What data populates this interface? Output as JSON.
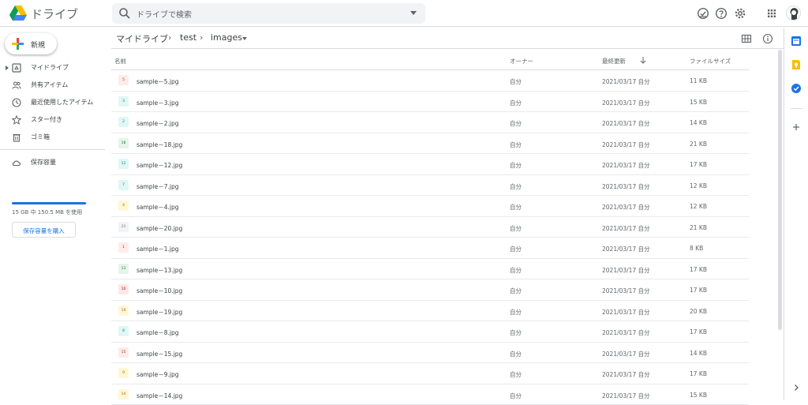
{
  "app": {
    "title": "ドライブ"
  },
  "search": {
    "placeholder": "ドライブで検索"
  },
  "topbar": {
    "icons": [
      "offline-status-icon",
      "help-icon",
      "settings-icon",
      "apps-grid-icon"
    ]
  },
  "sidebar": {
    "new_label": "新規",
    "items": [
      {
        "label": "マイドライブ",
        "icon": "my-drive-icon"
      },
      {
        "label": "共有アイテム",
        "icon": "shared-icon"
      },
      {
        "label": "最近使用したアイテム",
        "icon": "recent-icon"
      },
      {
        "label": "スター付き",
        "icon": "star-icon"
      },
      {
        "label": "ゴミ箱",
        "icon": "trash-icon"
      },
      {
        "label": "保存容量",
        "icon": "cloud-icon"
      }
    ],
    "storage_text": "15 GB 中 150.5 MB を使用",
    "storage_fraction": 0.98,
    "buy_label": "保存容量を購入"
  },
  "breadcrumb": {
    "root": "マイドライブ",
    "mid": "test",
    "current": "images",
    "sep": "›"
  },
  "columns": {
    "name": "名前",
    "owner": "オーナー",
    "modified": "最終更新",
    "size": "ファイルサイズ"
  },
  "files": [
    {
      "name": "sample－5.jpg",
      "thumb": "5",
      "owner": "自分",
      "modified": "2021/03/17 自分",
      "size": "11 KB",
      "color": "#fdecea",
      "fg": "#c5221f"
    },
    {
      "name": "sample－3.jpg",
      "thumb": "3",
      "owner": "自分",
      "modified": "2021/03/17 自分",
      "size": "15 KB",
      "color": "#e0f7f5",
      "fg": "#12857a"
    },
    {
      "name": "sample－2.jpg",
      "thumb": "2",
      "owner": "自分",
      "modified": "2021/03/17 自分",
      "size": "14 KB",
      "color": "#e0f7f5",
      "fg": "#12857a"
    },
    {
      "name": "sample－18.jpg",
      "thumb": "18",
      "owner": "自分",
      "modified": "2021/03/17 自分",
      "size": "21 KB",
      "color": "#e6f4ea",
      "fg": "#188038"
    },
    {
      "name": "sample－12.jpg",
      "thumb": "12",
      "owner": "自分",
      "modified": "2021/03/17 自分",
      "size": "17 KB",
      "color": "#e0f7f5",
      "fg": "#12857a"
    },
    {
      "name": "sample－7.jpg",
      "thumb": "7",
      "owner": "自分",
      "modified": "2021/03/17 自分",
      "size": "12 KB",
      "color": "#e0f7f5",
      "fg": "#12857a"
    },
    {
      "name": "sample－4.jpg",
      "thumb": "4",
      "owner": "自分",
      "modified": "2021/03/17 自分",
      "size": "12 KB",
      "color": "#fef7d6",
      "fg": "#b06000"
    },
    {
      "name": "sample－20.jpg",
      "thumb": "20",
      "owner": "自分",
      "modified": "2021/03/17 自分",
      "size": "21 KB",
      "color": "#f1f3f4",
      "fg": "#80868b"
    },
    {
      "name": "sample－1.jpg",
      "thumb": "1",
      "owner": "自分",
      "modified": "2021/03/17 自分",
      "size": "8 KB",
      "color": "#fdecea",
      "fg": "#c5221f"
    },
    {
      "name": "sample－13.jpg",
      "thumb": "13",
      "owner": "自分",
      "modified": "2021/03/17 自分",
      "size": "17 KB",
      "color": "#e6f4ea",
      "fg": "#188038"
    },
    {
      "name": "sample－10.jpg",
      "thumb": "10",
      "owner": "自分",
      "modified": "2021/03/17 自分",
      "size": "17 KB",
      "color": "#fce8e6",
      "fg": "#a50e0e"
    },
    {
      "name": "sample－19.jpg",
      "thumb": "19",
      "owner": "自分",
      "modified": "2021/03/17 自分",
      "size": "20 KB",
      "color": "#fef7d6",
      "fg": "#b06000"
    },
    {
      "name": "sample－8.jpg",
      "thumb": "8",
      "owner": "自分",
      "modified": "2021/03/17 自分",
      "size": "17 KB",
      "color": "#e0f7f5",
      "fg": "#12857a"
    },
    {
      "name": "sample－15.jpg",
      "thumb": "15",
      "owner": "自分",
      "modified": "2021/03/17 自分",
      "size": "14 KB",
      "color": "#fdecea",
      "fg": "#c5221f"
    },
    {
      "name": "sample－9.jpg",
      "thumb": "9",
      "owner": "自分",
      "modified": "2021/03/17 自分",
      "size": "17 KB",
      "color": "#fef7d6",
      "fg": "#b06000"
    },
    {
      "name": "sample－14.jpg",
      "thumb": "14",
      "owner": "自分",
      "modified": "2021/03/17 自分",
      "size": "15 KB",
      "color": "#fef7d6",
      "fg": "#b06000"
    }
  ],
  "rightbar": {
    "icons": [
      "calendar-icon",
      "keep-icon",
      "tasks-icon",
      "add-addon-icon",
      "expand-panel-icon"
    ]
  },
  "colors": {
    "accent": "#1a73e8",
    "divider": "#dadce0"
  }
}
